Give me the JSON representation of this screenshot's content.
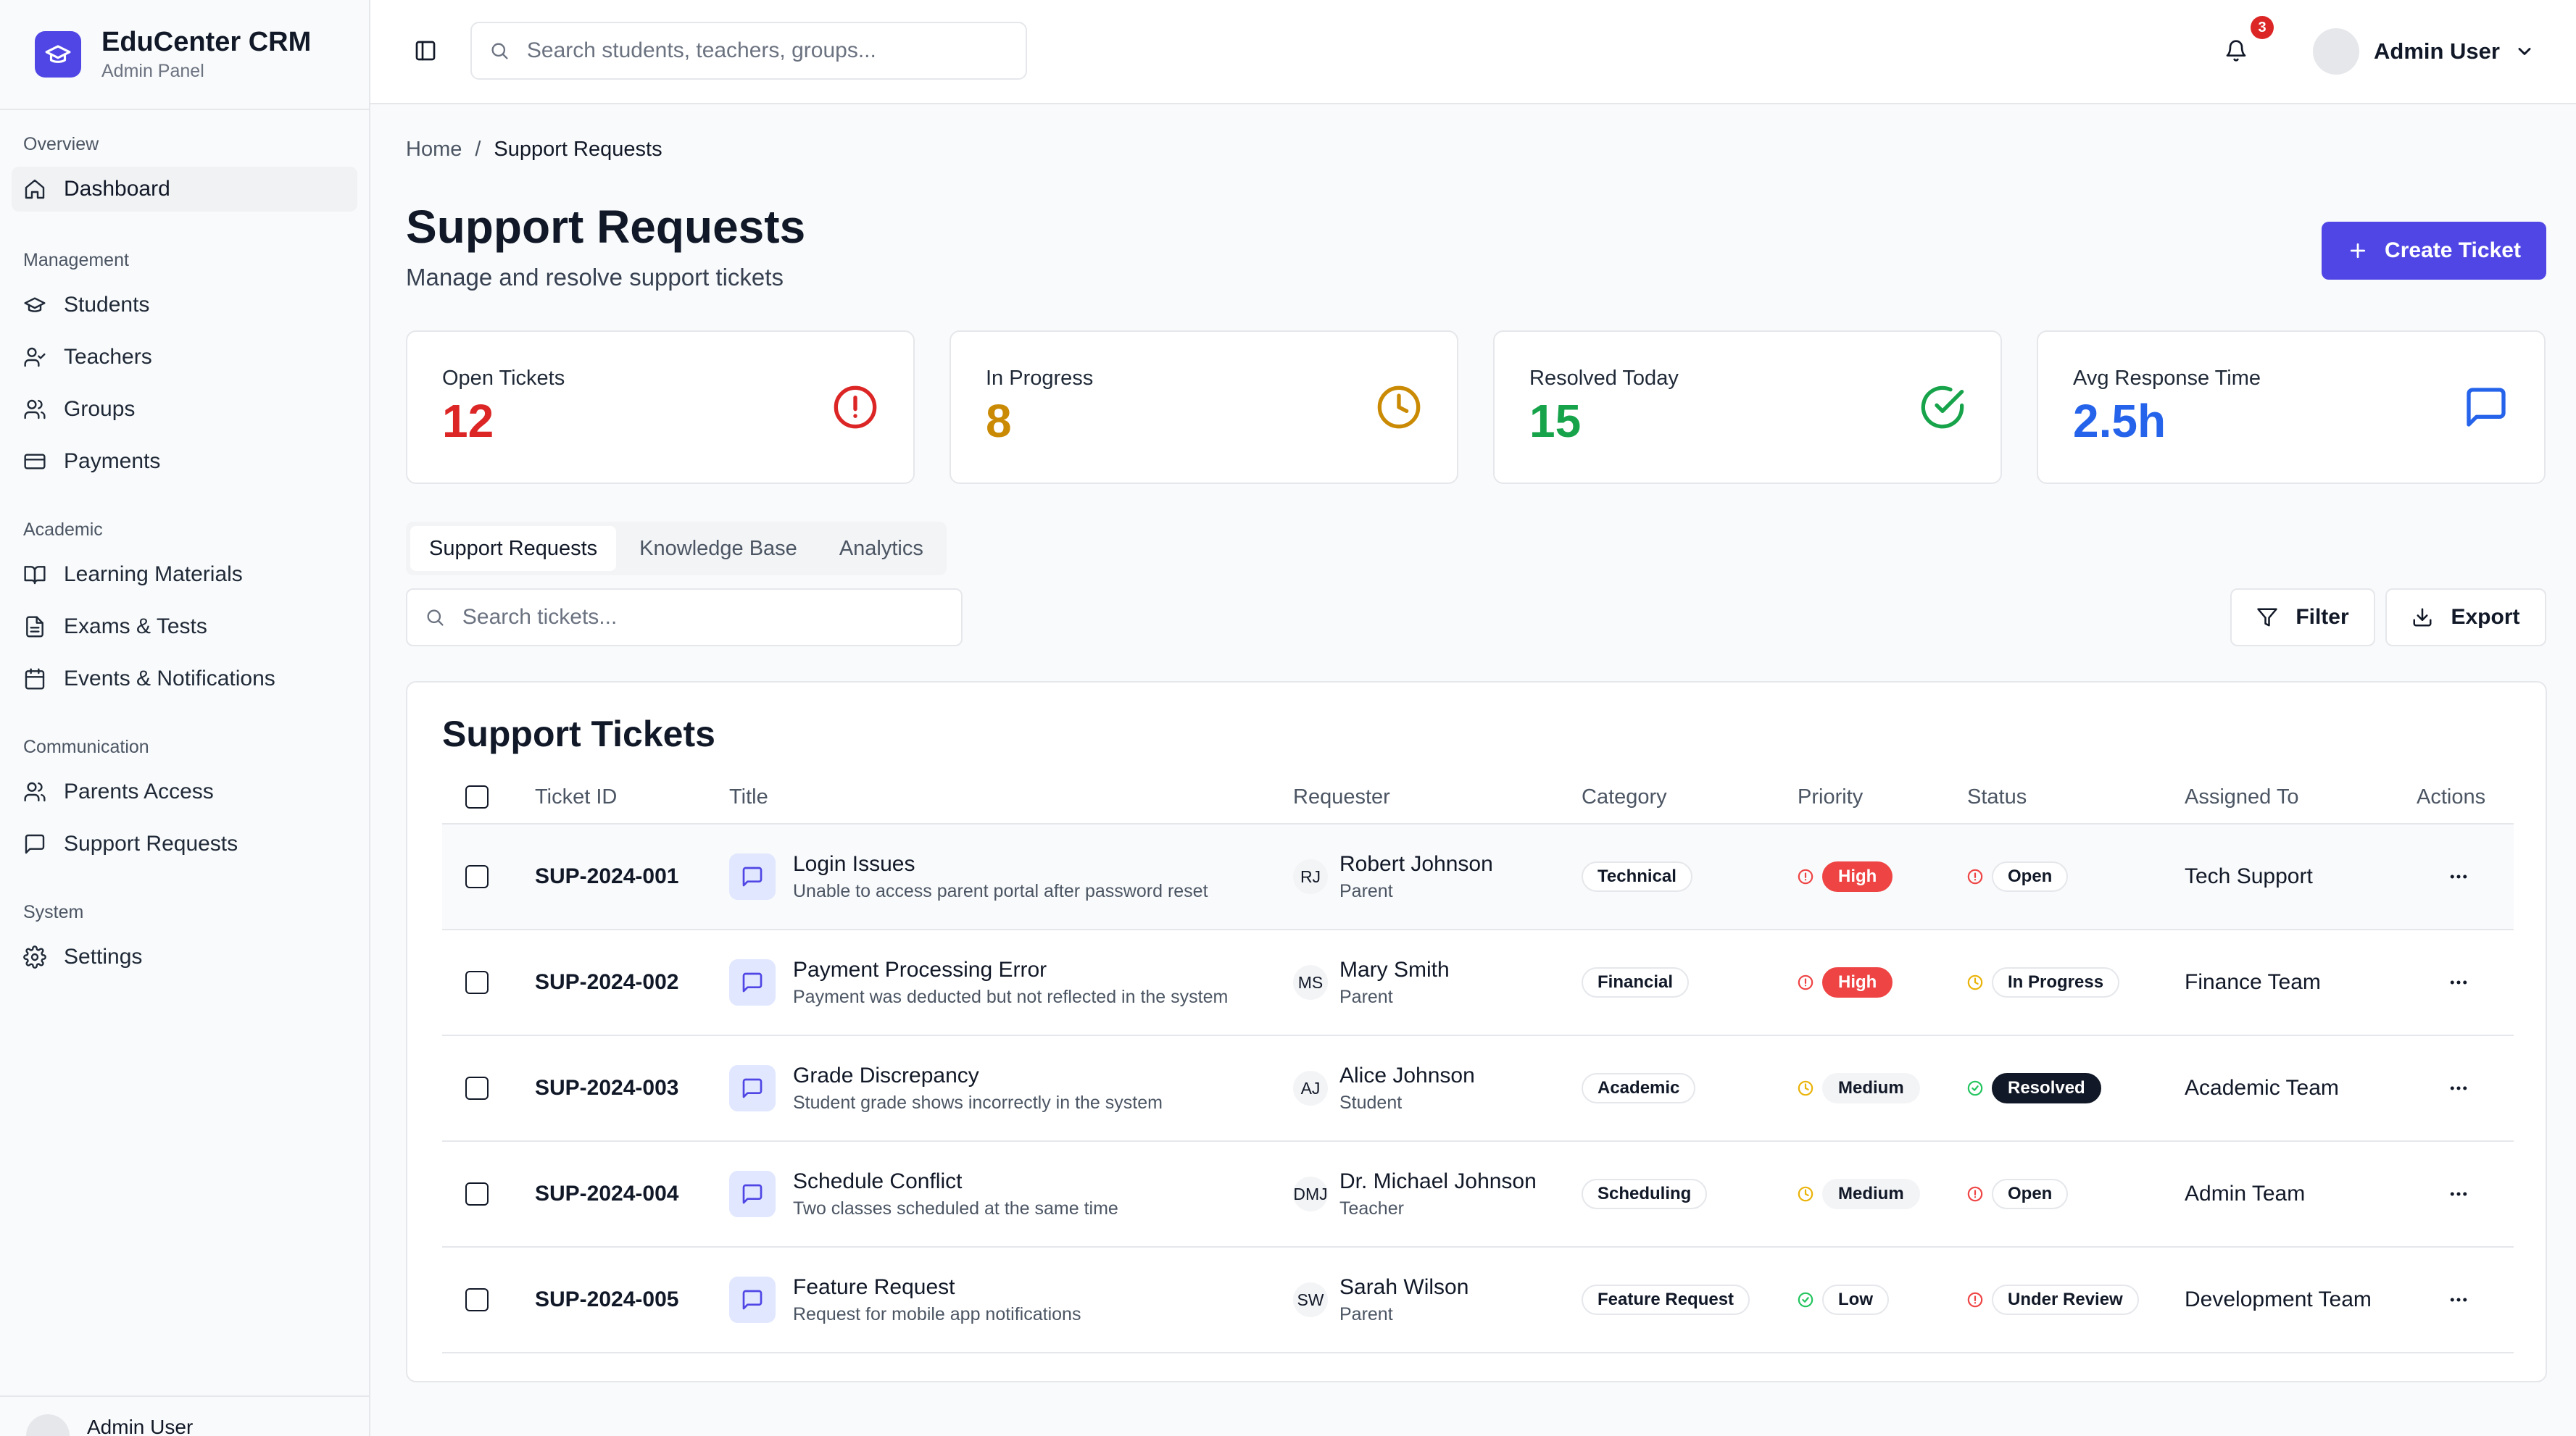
{
  "brand": {
    "name": "EduCenter CRM",
    "subtitle": "Admin Panel"
  },
  "sidebar": {
    "sections": [
      {
        "heading": "Overview",
        "items": [
          {
            "label": "Dashboard",
            "icon": "home-icon"
          }
        ]
      },
      {
        "heading": "Management",
        "items": [
          {
            "label": "Students",
            "icon": "graduation-cap-icon"
          },
          {
            "label": "Teachers",
            "icon": "user-check-icon"
          },
          {
            "label": "Groups",
            "icon": "users-icon"
          },
          {
            "label": "Payments",
            "icon": "credit-card-icon"
          }
        ]
      },
      {
        "heading": "Academic",
        "items": [
          {
            "label": "Learning Materials",
            "icon": "book-open-icon"
          },
          {
            "label": "Exams & Tests",
            "icon": "file-text-icon"
          },
          {
            "label": "Events & Notifications",
            "icon": "calendar-icon"
          }
        ]
      },
      {
        "heading": "Communication",
        "items": [
          {
            "label": "Parents Access",
            "icon": "users-icon"
          },
          {
            "label": "Support Requests",
            "icon": "message-square-icon"
          }
        ]
      },
      {
        "heading": "System",
        "items": [
          {
            "label": "Settings",
            "icon": "gear-icon"
          }
        ]
      }
    ],
    "active": "Dashboard",
    "footer_user": "Admin User"
  },
  "header": {
    "search_placeholder": "Search students, teachers, groups...",
    "notification_count": "3",
    "user_name": "Admin User"
  },
  "breadcrumb": {
    "home": "Home",
    "separator": "/",
    "current": "Support Requests"
  },
  "page": {
    "title": "Support Requests",
    "subtitle": "Manage and resolve support tickets",
    "create_button": "Create Ticket"
  },
  "stats": [
    {
      "label": "Open Tickets",
      "value": "12",
      "color": "#dc2626",
      "icon": "alert-circle-icon"
    },
    {
      "label": "In Progress",
      "value": "8",
      "color": "#ca8a04",
      "icon": "clock-icon"
    },
    {
      "label": "Resolved Today",
      "value": "15",
      "color": "#16a34a",
      "icon": "check-circle-icon"
    },
    {
      "label": "Avg Response Time",
      "value": "2.5h",
      "color": "#2563eb",
      "icon": "message-square-icon"
    }
  ],
  "tabs": [
    "Support Requests",
    "Knowledge Base",
    "Analytics"
  ],
  "active_tab": "Support Requests",
  "toolbar": {
    "search_placeholder": "Search tickets...",
    "filter_label": "Filter",
    "export_label": "Export"
  },
  "table": {
    "title": "Support Tickets",
    "columns": [
      "Ticket ID",
      "Title",
      "Requester",
      "Category",
      "Priority",
      "Status",
      "Assigned To",
      "Actions"
    ],
    "rows": [
      {
        "id": "SUP-2024-001",
        "title": "Login Issues",
        "desc": "Unable to access parent portal after password reset",
        "initials": "RJ",
        "requester": "Robert Johnson",
        "role": "Parent",
        "category": "Technical",
        "priority": "High",
        "status": "Open",
        "assigned": "Tech Support"
      },
      {
        "id": "SUP-2024-002",
        "title": "Payment Processing Error",
        "desc": "Payment was deducted but not reflected in the system",
        "initials": "MS",
        "requester": "Mary Smith",
        "role": "Parent",
        "category": "Financial",
        "priority": "High",
        "status": "In Progress",
        "assigned": "Finance Team"
      },
      {
        "id": "SUP-2024-003",
        "title": "Grade Discrepancy",
        "desc": "Student grade shows incorrectly in the system",
        "initials": "AJ",
        "requester": "Alice Johnson",
        "role": "Student",
        "category": "Academic",
        "priority": "Medium",
        "status": "Resolved",
        "assigned": "Academic Team"
      },
      {
        "id": "SUP-2024-004",
        "title": "Schedule Conflict",
        "desc": "Two classes scheduled at the same time",
        "initials": "DMJ",
        "requester": "Dr. Michael Johnson",
        "role": "Teacher",
        "category": "Scheduling",
        "priority": "Medium",
        "status": "Open",
        "assigned": "Admin Team"
      },
      {
        "id": "SUP-2024-005",
        "title": "Feature Request",
        "desc": "Request for mobile app notifications",
        "initials": "SW",
        "requester": "Sarah Wilson",
        "role": "Parent",
        "category": "Feature Request",
        "priority": "Low",
        "status": "Under Review",
        "assigned": "Development Team"
      }
    ]
  },
  "colors": {
    "accent": "#4f46e5",
    "priority_high": "#ef4444",
    "priority_medium": "#eab308",
    "priority_low": "#22c55e",
    "status_open": "#ef4444",
    "status_in_progress": "#eab308",
    "status_resolved": "#22c55e",
    "status_under_review": "#ef4444"
  }
}
